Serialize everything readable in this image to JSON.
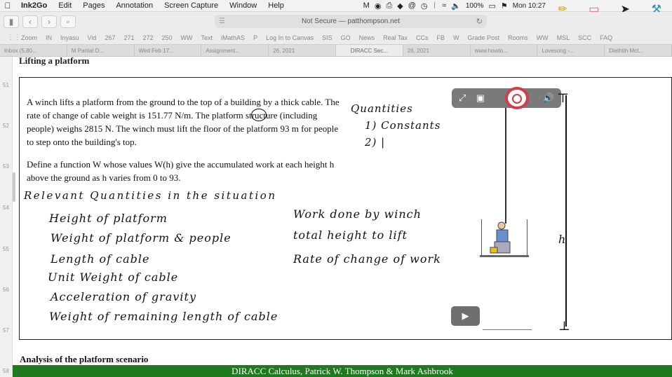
{
  "menubar": {
    "app": "Ink2Go",
    "items": [
      "Edit",
      "Pages",
      "Annotation",
      "Screen Capture",
      "Window",
      "Help"
    ],
    "battery": "100%",
    "clock": "Mon 10:27"
  },
  "browser": {
    "url": "Not Secure — patthompson.net",
    "bookmarks": [
      "Zoom",
      "IN",
      "Inyasu",
      "Vid",
      "267",
      "271",
      "272",
      "250",
      "WW",
      "Text",
      "iMathAS",
      "P",
      "Log In to Canvas",
      "SIS",
      "GO",
      "News",
      "Real Tax",
      "CCs",
      "FB",
      "W",
      "Grade Post",
      "Rooms",
      "WW",
      "MSL",
      "SCC",
      "FAQ"
    ],
    "tabs": [
      "Inbox (5,80...",
      "M Partial D...",
      "Wed Feb 17...",
      "Assignment...",
      "26, 2021",
      "DIRACC Sec...",
      "26, 2021",
      "www.howto...",
      "Lovesong -...",
      "Diethtih Mct..."
    ]
  },
  "page": {
    "heading_top": "Lifting a platform",
    "line_numbers": [
      "51",
      "52",
      "53",
      "54",
      "55",
      "56",
      "57",
      "58"
    ],
    "problem_p1": "A winch lifts a platform from the ground to the top of a building by a thick cable. The rate of change of cable weight is 151.77 N/m. The platform structure (including people) weighs 2815 N. The winch must lift the floor of the platform 93 m for people to step onto the building's top.",
    "problem_p2": "Define a function W whose values W(h) give the accumulated work at each height h above the ground as h varies from 0 to 93.",
    "footer_heading": "Analysis of the platform scenario",
    "footer_bar": "DIRACC Calculus, Patrick W. Thompson & Mark Ashbrook"
  },
  "handwriting": {
    "quantities": "Quantities",
    "constants": "1) Constants",
    "item2": "2) |",
    "relevant": "Relevant Quantities in the situation",
    "left_items": [
      "Height of platform",
      "Weight of platform & people",
      "Length of cable",
      "Unit Weight of cable",
      "Acceleration of gravity",
      "Weight of remaining length of cable"
    ],
    "right_items": [
      "Work done by winch",
      "total height to lift",
      "Rate of change of work"
    ],
    "tick": "h"
  }
}
